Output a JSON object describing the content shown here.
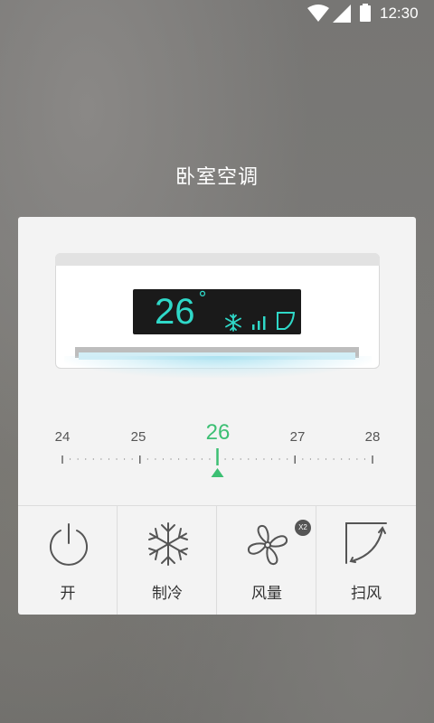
{
  "status_bar": {
    "time": "12:30",
    "icons": [
      "wifi-icon",
      "signal-icon",
      "battery-icon"
    ]
  },
  "title": "卧室空调",
  "ac_display": {
    "temperature": "26",
    "degree_symbol": "°",
    "mode_icon": "snowflake-icon",
    "fan_icon": "fan-level-icon",
    "swing_icon": "swing-icon",
    "display_color": "#2fd8c8"
  },
  "ruler": {
    "labels": [
      "24",
      "25",
      "26",
      "27",
      "28"
    ],
    "selected": "26",
    "accent_color": "#3cbf73"
  },
  "controls": [
    {
      "label": "开",
      "icon": "power-icon"
    },
    {
      "label": "制冷",
      "icon": "snowflake-icon"
    },
    {
      "label": "风量",
      "icon": "fan-icon",
      "badge": "X2"
    },
    {
      "label": "扫风",
      "icon": "swing-icon"
    }
  ]
}
